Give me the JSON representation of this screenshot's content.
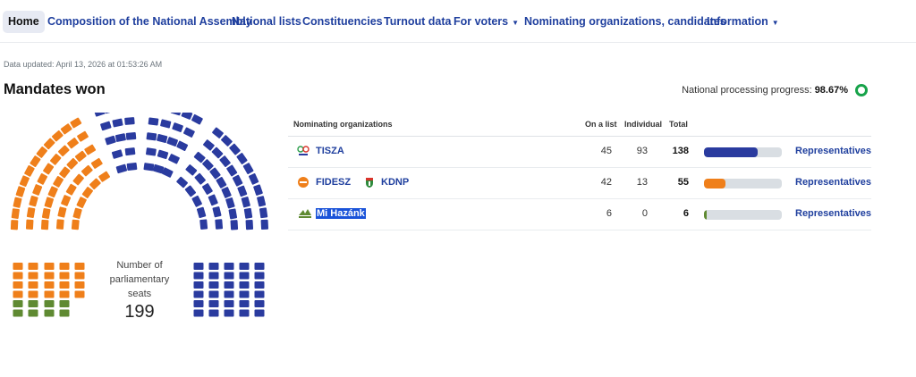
{
  "nav": {
    "items": [
      {
        "label": "Home",
        "active": true
      },
      {
        "label": "Composition of the National Assembly"
      },
      {
        "label": "National lists"
      },
      {
        "label": "Constituencies"
      },
      {
        "label": "Turnout data"
      },
      {
        "label": "For voters",
        "dropdown": true
      },
      {
        "label": "Nominating organizations, candidates"
      },
      {
        "label": "Information",
        "dropdown": true
      }
    ],
    "caret": "▼"
  },
  "data_updated": "Data updated: April 13, 2026 at 01:53:26 AM",
  "title": "Mandates won",
  "progress": {
    "label": "National processing progress: ",
    "value": "98.67%"
  },
  "seats": {
    "caption": "Number of parliamentary seats",
    "caption_lines": [
      "Number of",
      "parliamentary",
      "seats"
    ],
    "total": "199",
    "colors": {
      "tisza": "#2a3b9f",
      "fidesz": "#ef7f1a",
      "mihazank": "#5f8a32"
    }
  },
  "table": {
    "headers": {
      "org": "Nominating organizations",
      "list": "On a list",
      "individual": "Individual",
      "total": "Total"
    },
    "rows": [
      {
        "parties": [
          "TISZA"
        ],
        "list": "45",
        "individual": "93",
        "total": "138",
        "share": 0.6935,
        "color": "#2a3b9f",
        "link": "Representatives"
      },
      {
        "parties": [
          "FIDESZ",
          "KDNP"
        ],
        "list": "42",
        "individual": "13",
        "total": "55",
        "share": 0.2764,
        "color": "#ef7f1a",
        "link": "Representatives"
      },
      {
        "parties": [
          "Mi Hazánk"
        ],
        "list": "6",
        "individual": "0",
        "total": "6",
        "share": 0.0302,
        "color": "#5f8a32",
        "link": "Representatives"
      }
    ]
  }
}
